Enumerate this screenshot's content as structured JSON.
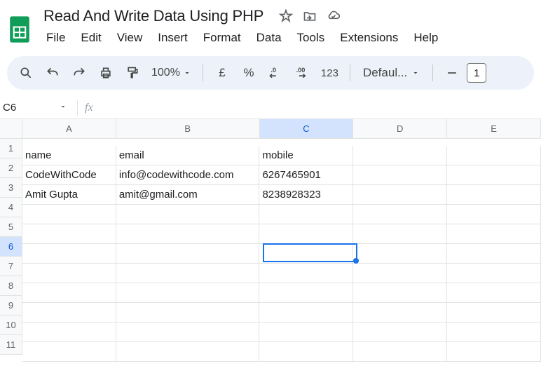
{
  "doc_title": "Read And Write Data Using PHP",
  "menu": {
    "file": "File",
    "edit": "Edit",
    "view": "View",
    "insert": "Insert",
    "format": "Format",
    "data": "Data",
    "tools": "Tools",
    "extensions": "Extensions",
    "help": "Help"
  },
  "toolbar": {
    "zoom": "100%",
    "currency": "£",
    "percent": "%",
    "numfmt": "123",
    "font": "Defaul...",
    "fsize": "1"
  },
  "namebox": "C6",
  "columns": [
    "A",
    "B",
    "C",
    "D",
    "E"
  ],
  "rows": [
    "1",
    "2",
    "3",
    "4",
    "5",
    "6",
    "7",
    "8",
    "9",
    "10",
    "11"
  ],
  "selected": {
    "row": "6",
    "col": "C"
  },
  "data": {
    "r1": {
      "a": "name",
      "b": "email",
      "c": "mobile"
    },
    "r2": {
      "a": "CodeWithCode",
      "b": "info@codewithcode.com",
      "c": "6267465901"
    },
    "r3": {
      "a": "Amit Gupta",
      "b": "amit@gmail.com",
      "c": "8238928323"
    }
  }
}
